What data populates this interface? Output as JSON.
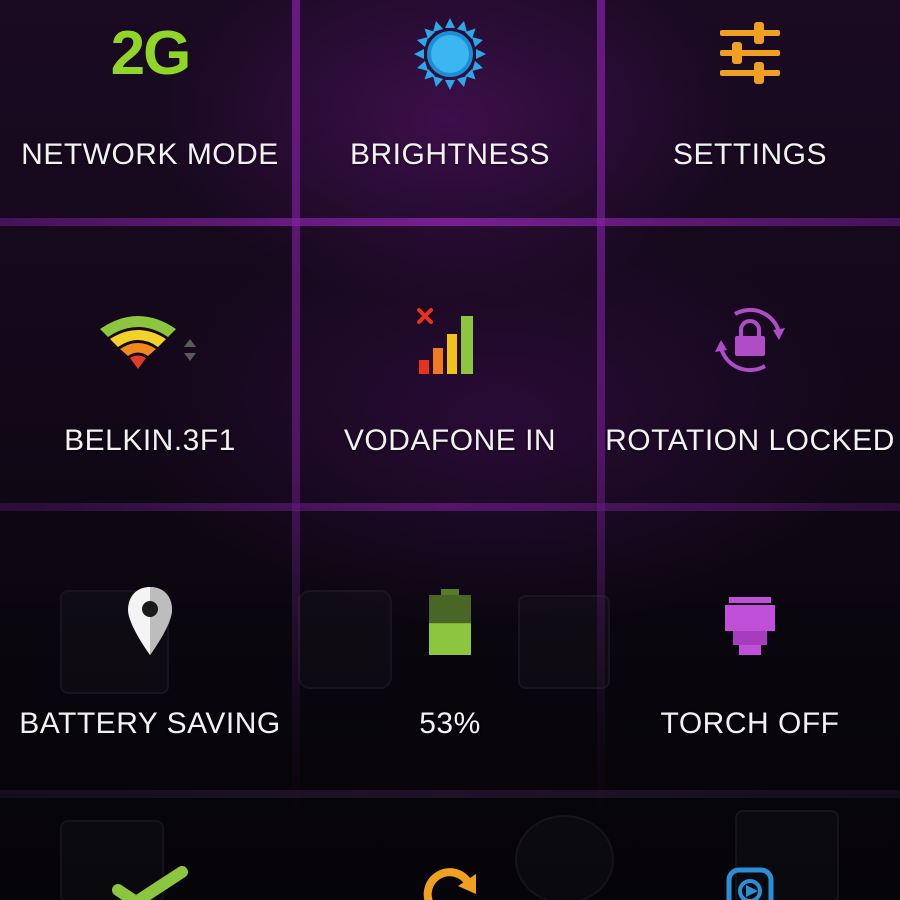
{
  "colors": {
    "accent_purple": "#9b2bbf",
    "network_green": "#8fd629",
    "brightness_blue": "#2aa8ea",
    "settings_orange": "#f0a020",
    "rotation_magenta": "#b04cc8",
    "battery_green": "#8cc63f",
    "torch_magenta": "#c050d8",
    "label_white": "#f2f2f2"
  },
  "tiles": [
    {
      "label": "NETWORK MODE",
      "icon": "network-2g-icon",
      "icon_text": "2G"
    },
    {
      "label": "BRIGHTNESS",
      "icon": "brightness-sun-icon"
    },
    {
      "label": "SETTINGS",
      "icon": "settings-sliders-icon"
    },
    {
      "label": "BELKIN.3F1",
      "icon": "wifi-signal-icon"
    },
    {
      "label": "VODAFONE IN",
      "icon": "cellular-signal-icon"
    },
    {
      "label": "ROTATION LOCKED",
      "icon": "rotation-lock-icon"
    },
    {
      "label": "BATTERY SAVING",
      "icon": "location-pin-icon"
    },
    {
      "label": "53%",
      "icon": "battery-icon",
      "level": 0.53
    },
    {
      "label": "TORCH OFF",
      "icon": "torch-icon"
    },
    {
      "label": "",
      "icon": "checkmark-icon"
    },
    {
      "label": "",
      "icon": "sync-icon"
    },
    {
      "label": "",
      "icon": "music-player-icon"
    }
  ]
}
